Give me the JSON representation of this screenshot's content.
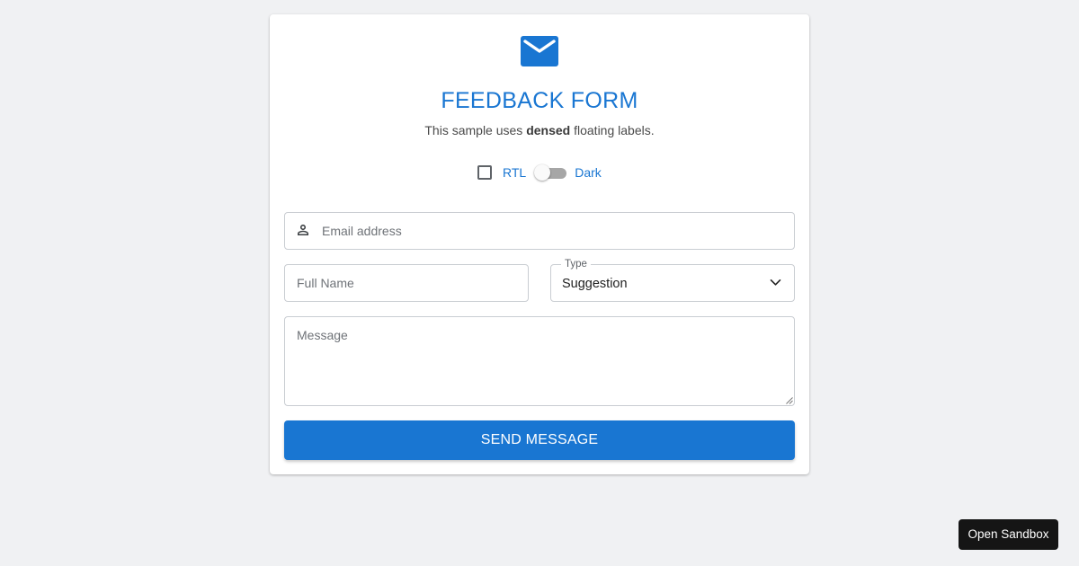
{
  "colors": {
    "accent": "#1976d2",
    "background": "#f0f1f3",
    "card": "#ffffff",
    "sandbox_button": "#151515"
  },
  "header": {
    "icon": "mail-icon",
    "title": "FEEDBACK FORM",
    "subtitle_before": "This sample uses ",
    "subtitle_bold": "densed",
    "subtitle_after": " floating labels."
  },
  "options": {
    "rtl_label": "RTL",
    "rtl_checked": false,
    "dark_label": "Dark",
    "dark_enabled": false
  },
  "form": {
    "email": {
      "icon": "person-icon",
      "placeholder": "Email address",
      "value": ""
    },
    "full_name": {
      "placeholder": "Full Name",
      "value": ""
    },
    "type": {
      "label": "Type",
      "selected": "Suggestion"
    },
    "message": {
      "placeholder": "Message",
      "value": ""
    },
    "submit_label": "SEND MESSAGE"
  },
  "sandbox": {
    "label": "Open Sandbox"
  }
}
